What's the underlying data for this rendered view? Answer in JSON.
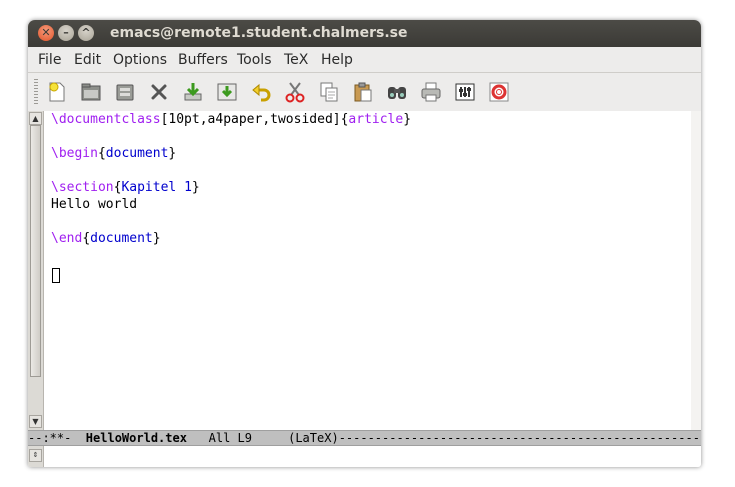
{
  "window": {
    "title": "emacs@remote1.student.chalmers.se"
  },
  "menubar": {
    "items": [
      "File",
      "Edit",
      "Options",
      "Buffers",
      "Tools",
      "TeX",
      "Help"
    ]
  },
  "toolbar": {
    "icons": [
      "new-file-icon",
      "open-folder-icon",
      "dired-icon",
      "close-buffer-icon",
      "save-icon",
      "save-as-icon",
      "undo-icon",
      "cut-icon",
      "copy-icon",
      "paste-icon",
      "search-icon",
      "print-icon",
      "preferences-icon",
      "help-icon"
    ]
  },
  "editor": {
    "line1": {
      "cmd": "\\documentclass",
      "opt": "[10pt,a4paper,twosided]",
      "lb": "{",
      "arg": "article",
      "rb": "}"
    },
    "line3": {
      "cmd": "\\begin",
      "lb": "{",
      "arg": "document",
      "rb": "}"
    },
    "line5": {
      "cmd": "\\section",
      "lb": "{",
      "arg": "Kapitel 1",
      "rb": "}"
    },
    "line6": {
      "text": "Hello world"
    },
    "line8": {
      "cmd": "\\end",
      "lb": "{",
      "arg": "document",
      "rb": "}"
    }
  },
  "modeline": {
    "status": "--:**-  ",
    "buffer": "HelloWorld.tex",
    "position": "   All L9     ",
    "mode": "(LaTeX)",
    "fill": "------------------------------------------------------------"
  },
  "colors": {
    "keyword": "#a020f0",
    "argument": "#0000cd",
    "titlebar": "#3b3a36"
  }
}
